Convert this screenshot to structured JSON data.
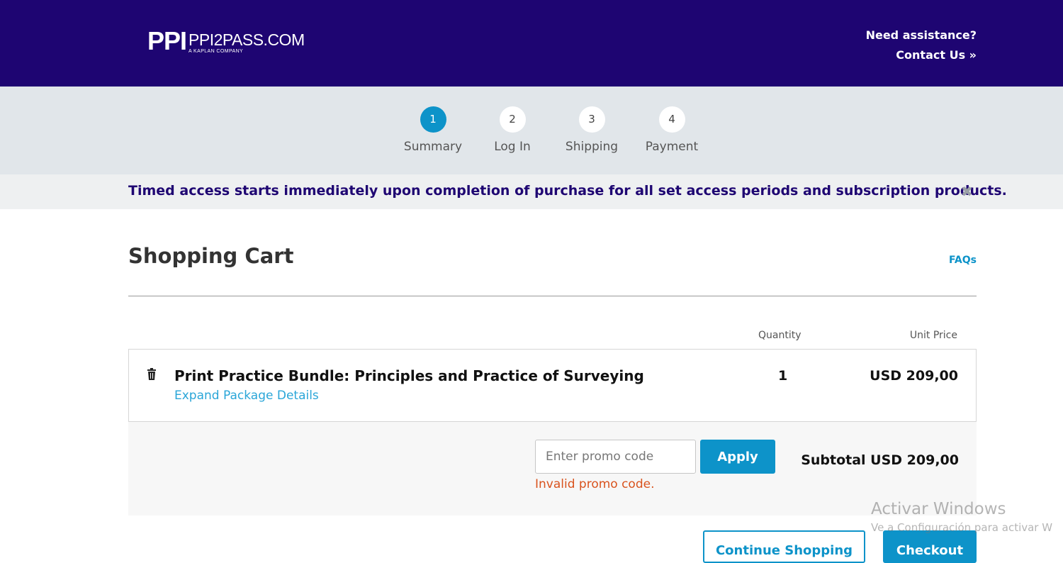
{
  "header": {
    "logo_mark": "PPI",
    "logo_site": "PPI2PASS.COM",
    "logo_sub": "A KAPLAN COMPANY",
    "assist_line1": "Need assistance?",
    "assist_line2": "Contact Us »"
  },
  "steps": [
    {
      "number": "1",
      "label": "Summary",
      "active": true
    },
    {
      "number": "2",
      "label": "Log In",
      "active": false
    },
    {
      "number": "3",
      "label": "Shipping",
      "active": false
    },
    {
      "number": "4",
      "label": "Payment",
      "active": false
    }
  ],
  "notice": {
    "text": "Timed access starts immediately upon completion of purchase for all set access periods and subscription products.",
    "close_glyph": "✖"
  },
  "cart": {
    "title": "Shopping Cart",
    "faqs_label": "FAQs",
    "col_quantity": "Quantity",
    "col_unit_price": "Unit Price",
    "item": {
      "name": "Print Practice Bundle: Principles and Practice of Surveying",
      "expand_label": "Expand Package Details",
      "quantity": "1",
      "unit_price": "USD 209,00",
      "delete_icon": "trash-icon"
    },
    "promo": {
      "placeholder": "Enter promo code",
      "value": "",
      "apply_label": "Apply",
      "error": "Invalid promo code."
    },
    "subtotal": "Subtotal USD 209,00",
    "continue_label": "Continue Shopping",
    "checkout_label": "Checkout"
  },
  "watermark": {
    "line1": "Activar Windows",
    "line2": "Ve a Configuración para activar W"
  },
  "colors": {
    "header_bg": "#1e0572",
    "accent": "#0d93c9",
    "error": "#d9531e"
  }
}
